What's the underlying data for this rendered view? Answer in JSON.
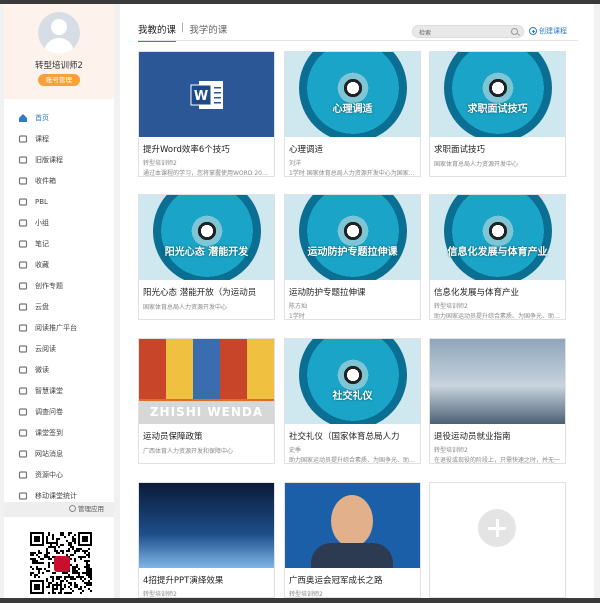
{
  "profile": {
    "username": "转型培训师2",
    "role_badge": "账号管理"
  },
  "nav": [
    {
      "label": "首页",
      "icon": "home-icon",
      "active": true
    },
    {
      "label": "课程",
      "icon": "course-icon"
    },
    {
      "label": "旧版课程",
      "icon": "old-course-icon"
    },
    {
      "label": "收件箱",
      "icon": "inbox-icon"
    },
    {
      "label": "PBL",
      "icon": "pbl-icon"
    },
    {
      "label": "小组",
      "icon": "group-icon"
    },
    {
      "label": "笔记",
      "icon": "note-icon"
    },
    {
      "label": "收藏",
      "icon": "favorite-icon"
    },
    {
      "label": "创作专题",
      "icon": "topic-icon"
    },
    {
      "label": "云盘",
      "icon": "cloud-icon"
    },
    {
      "label": "阅读推广平台",
      "icon": "reading-icon"
    },
    {
      "label": "云阅读",
      "icon": "cloud-reading-icon"
    },
    {
      "label": "微读",
      "icon": "micro-read-icon"
    },
    {
      "label": "智慧课堂",
      "icon": "smart-class-icon"
    },
    {
      "label": "调查问卷",
      "icon": "survey-icon"
    },
    {
      "label": "课堂签到",
      "icon": "checkin-icon"
    },
    {
      "label": "网站消息",
      "icon": "message-icon"
    },
    {
      "label": "资源中心",
      "icon": "resource-icon"
    },
    {
      "label": "移动课堂统计",
      "icon": "stats-icon"
    }
  ],
  "manage_label": "管理应用",
  "tabs": {
    "my_teaching": "我教的课",
    "my_learning": "我学的课"
  },
  "search": {
    "value": "检索"
  },
  "create_label": "创建课程",
  "courses": [
    {
      "title": "提升Word效率6个技巧",
      "teacher": "转型培训师2",
      "desc": "通过本课程的学习，您将掌握使用WORD 2010提升效率的技巧",
      "thumb": "word",
      "thumb_text": ""
    },
    {
      "title": "心理调适",
      "teacher": "刘洋",
      "desc": "1学时  国家体育总局人力资源开发中心为国家队运动员提供",
      "thumb": "disc",
      "thumb_text": "心理调适"
    },
    {
      "title": "求职面试技巧",
      "teacher": "",
      "desc": "国家体育总局人力资源开发中心",
      "thumb": "disc",
      "thumb_text": "求职面试技巧"
    },
    {
      "title": "阳光心态 潜能开放（为运动员",
      "teacher": "",
      "desc": "国家体育总局人力资源开发中心",
      "thumb": "disc",
      "thumb_text": "阳光心态  潜能开发"
    },
    {
      "title": "运动防护专题拉伸课",
      "teacher": "陈方灿",
      "desc": "1学时",
      "thumb": "disc",
      "thumb_text": "运动防护专题拉伸课"
    },
    {
      "title": "信息化发展与体育产业",
      "teacher": "转型培训师2",
      "desc": "助力国家运动员提升综合素质、为国争光、助力退役",
      "thumb": "disc",
      "thumb_text": "信息化发展与体育产业"
    },
    {
      "title": "运动员保障政策",
      "teacher": "",
      "desc": "广西体育人力资源开发和保障中心",
      "thumb": "sports",
      "thumb_text": "ZHISHI WENDA"
    },
    {
      "title": "社交礼仪（国家体育总局人力",
      "teacher": "史季",
      "desc": "助力国家运动员提升综合素质、为国争光、助力退役",
      "thumb": "disc",
      "thumb_text": "社交礼仪"
    },
    {
      "title": "退役运动员就业指南",
      "teacher": "转型培训师2",
      "desc": "在退役或现役的阶段上，只需快速之时，并无一",
      "thumb": "job",
      "thumb_text": ""
    },
    {
      "title": "4招提升PPT演绎效果",
      "teacher": "转型培训师2",
      "desc": "",
      "thumb": "space",
      "thumb_text": ""
    },
    {
      "title": "广西奥运会冠军成长之路",
      "teacher": "转型培训师2",
      "desc": "",
      "thumb": "portrait",
      "thumb_text": ""
    },
    {
      "title": "",
      "teacher": "",
      "desc": "",
      "thumb": "add",
      "thumb_text": ""
    }
  ],
  "colors": {
    "accent": "#2f7ccc",
    "badge": "#f5a23a"
  }
}
